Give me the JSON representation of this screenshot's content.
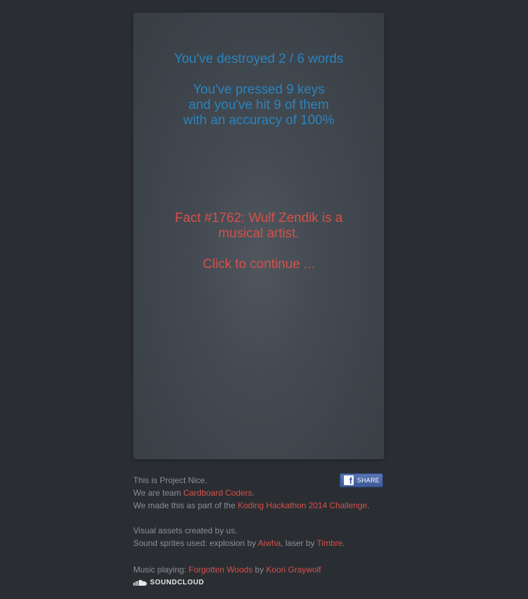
{
  "game": {
    "destroyed": "You've destroyed 2 / 6 words",
    "pressed_lines": [
      "You've pressed 9 keys",
      "and you've hit 9 of them",
      "with an accuracy of 100%"
    ],
    "fact": "Fact #1762:  Wulf Zendik is a musical artist.",
    "continue": "Click to continue ..."
  },
  "share": {
    "label": "SHARE",
    "icon": "facebook-icon"
  },
  "footer": {
    "line1": "This is Project Nice.",
    "line2_prefix": "We are team ",
    "team_link": "Cardboard Coders",
    "line2_suffix": ".",
    "line3_prefix": "We made this as part of the ",
    "hackathon_link": "Koding Hackathon 2014 Challenge",
    "line3_suffix": ".",
    "line4": "Visual assets created by us.",
    "line5_prefix": "Sound sprites used: explosion by ",
    "explosion_link": "Aiwha",
    "line5_mid": ", laser by ",
    "laser_link": "Timbre",
    "line5_suffix": ".",
    "music_prefix": "Music playing: ",
    "music_link": "Forgotten Woods",
    "music_mid": " by ",
    "artist_link": "Koori Graywolf",
    "soundcloud_label": "SOUNDCLOUD",
    "soundcloud_icon": "soundcloud-icon"
  },
  "colors": {
    "background": "#2a2e33",
    "stats_blue": "#2b84bf",
    "accent_red": "#d6504a",
    "facebook_blue": "#3d5a98"
  }
}
